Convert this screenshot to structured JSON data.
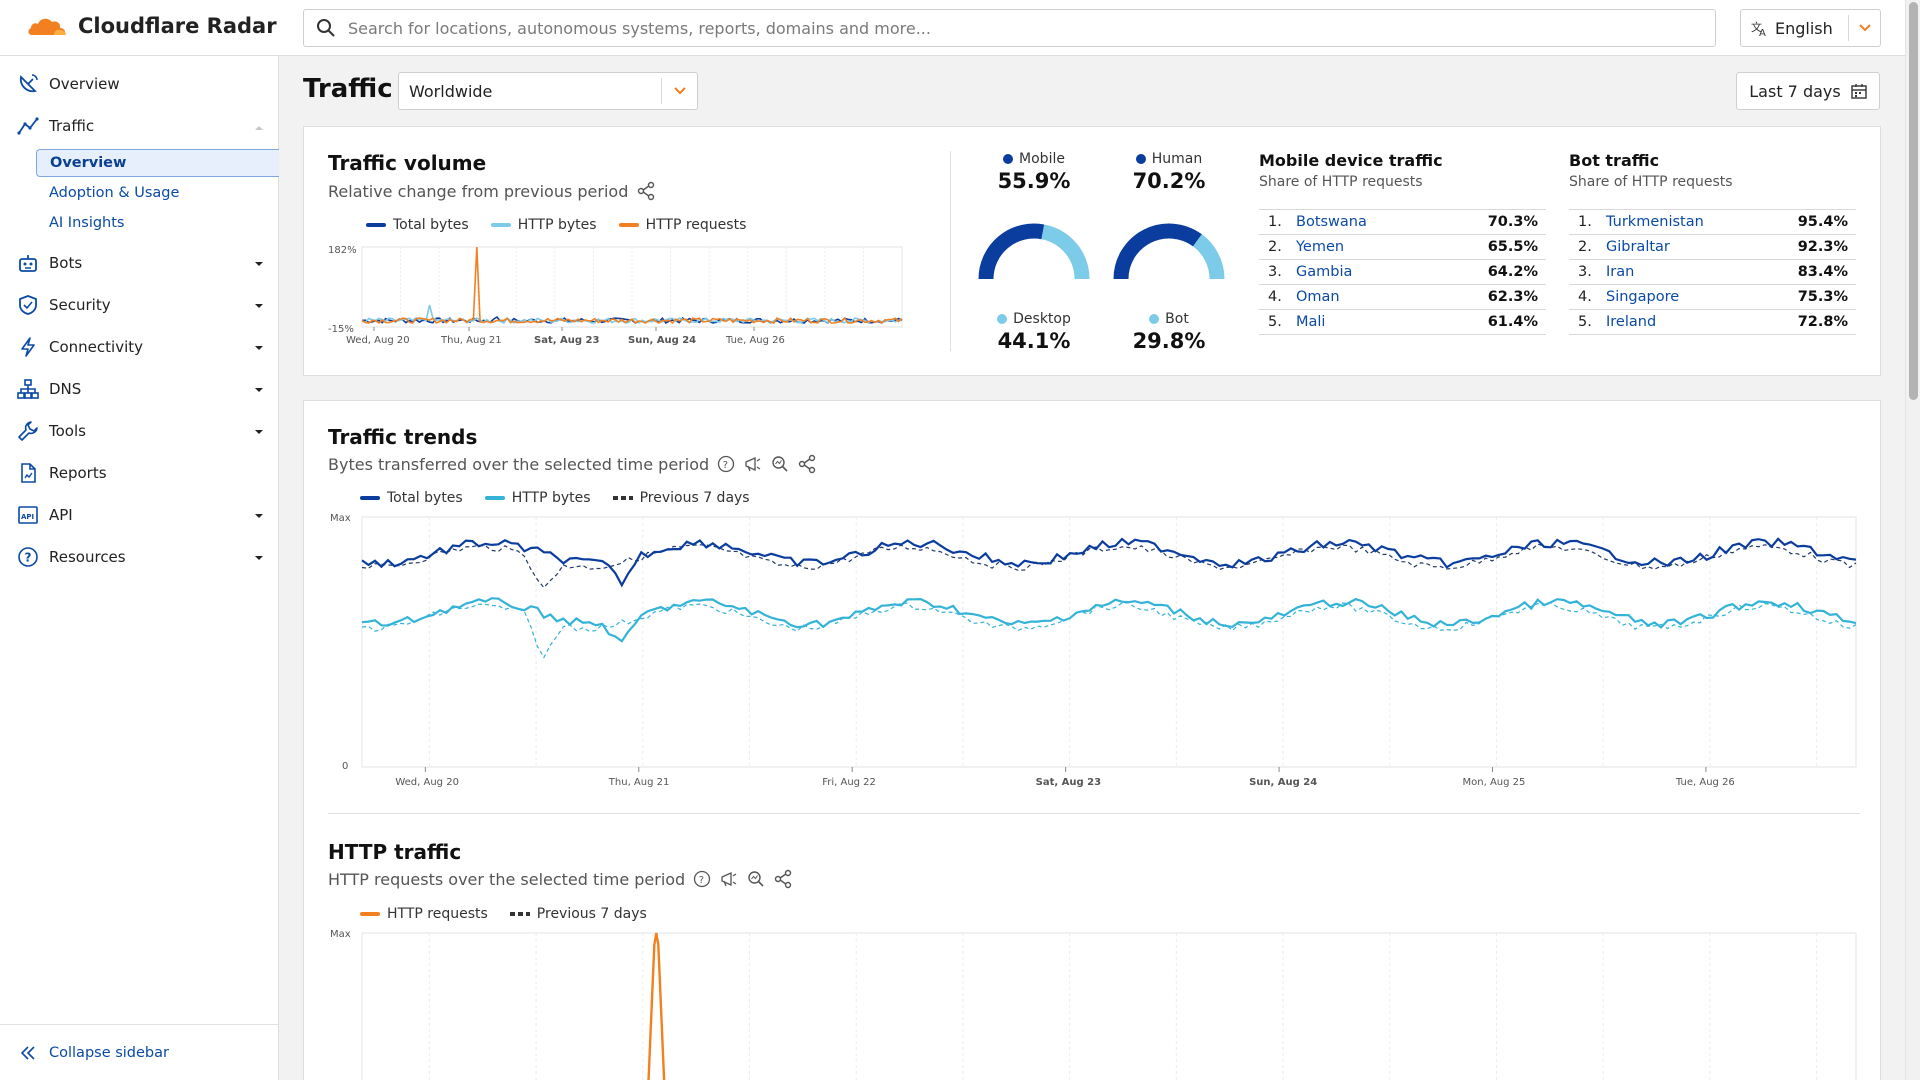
{
  "header": {
    "brand": "Cloudflare Radar",
    "search_placeholder": "Search for locations, autonomous systems, reports, domains and more...",
    "language": "English"
  },
  "sidebar": {
    "items": [
      {
        "label": "Overview",
        "icon": "satellite-dish-icon"
      },
      {
        "label": "Traffic",
        "icon": "trend-line-icon"
      },
      {
        "label": "Bots",
        "icon": "robot-icon"
      },
      {
        "label": "Security",
        "icon": "shield-icon"
      },
      {
        "label": "Connectivity",
        "icon": "lightning-icon"
      },
      {
        "label": "DNS",
        "icon": "hierarchy-icon"
      },
      {
        "label": "Tools",
        "icon": "wrench-icon"
      },
      {
        "label": "Reports",
        "icon": "document-icon"
      },
      {
        "label": "API",
        "icon": "api-icon"
      },
      {
        "label": "Resources",
        "icon": "question-icon"
      }
    ],
    "traffic_sub": [
      "Overview",
      "Adoption & Usage",
      "AI Insights"
    ],
    "collapse_label": "Collapse sidebar"
  },
  "page": {
    "title": "Traffic",
    "region": "Worldwide",
    "date_range": "Last 7 days"
  },
  "traffic_volume": {
    "title": "Traffic volume",
    "subtitle": "Relative change from previous period",
    "legend": [
      "Total bytes",
      "HTTP bytes",
      "HTTP requests"
    ],
    "y_labels": [
      "182%",
      "-15%"
    ],
    "x_labels": [
      "Wed, Aug 20",
      "Thu, Aug 21",
      "Sat, Aug 23",
      "Sun, Aug 24",
      "Tue, Aug 26"
    ]
  },
  "device": {
    "mobile_label": "Mobile",
    "mobile_value": "55.9%",
    "mobile_share": 0.559,
    "desktop_label": "Desktop",
    "desktop_value": "44.1%",
    "human_label": "Human",
    "human_value": "70.2%",
    "human_share": 0.702,
    "bot_label": "Bot",
    "bot_value": "29.8%"
  },
  "mobile_device_traffic": {
    "title": "Mobile device traffic",
    "subtitle": "Share of HTTP requests",
    "rows": [
      {
        "rank": "1.",
        "name": "Botswana",
        "value": "70.3%"
      },
      {
        "rank": "2.",
        "name": "Yemen",
        "value": "65.5%"
      },
      {
        "rank": "3.",
        "name": "Gambia",
        "value": "64.2%"
      },
      {
        "rank": "4.",
        "name": "Oman",
        "value": "62.3%"
      },
      {
        "rank": "5.",
        "name": "Mali",
        "value": "61.4%"
      }
    ]
  },
  "bot_traffic": {
    "title": "Bot traffic",
    "subtitle": "Share of HTTP requests",
    "rows": [
      {
        "rank": "1.",
        "name": "Turkmenistan",
        "value": "95.4%"
      },
      {
        "rank": "2.",
        "name": "Gibraltar",
        "value": "92.3%"
      },
      {
        "rank": "3.",
        "name": "Iran",
        "value": "83.4%"
      },
      {
        "rank": "4.",
        "name": "Singapore",
        "value": "75.3%"
      },
      {
        "rank": "5.",
        "name": "Ireland",
        "value": "72.8%"
      }
    ]
  },
  "traffic_trends": {
    "title": "Traffic trends",
    "subtitle": "Bytes transferred over the selected time period",
    "legend": [
      "Total bytes",
      "HTTP bytes",
      "Previous 7 days"
    ],
    "y_labels": [
      "Max",
      "0"
    ],
    "x_labels": [
      "Wed, Aug 20",
      "Thu, Aug 21",
      "Fri, Aug 22",
      "Sat, Aug 23",
      "Sun, Aug 24",
      "Mon, Aug 25",
      "Tue, Aug 26"
    ]
  },
  "http_traffic": {
    "title": "HTTP traffic",
    "subtitle": "HTTP requests over the selected time period",
    "legend": [
      "HTTP requests",
      "Previous 7 days"
    ],
    "y_labels": [
      "Max"
    ]
  },
  "colors": {
    "total_bytes": "#0a3d9e",
    "http_bytes": "#33b3d8",
    "http_requests": "#f38020",
    "mobile": "#0a3d9e",
    "desktop": "#7ccbe9",
    "link": "#0b4aa5"
  }
}
